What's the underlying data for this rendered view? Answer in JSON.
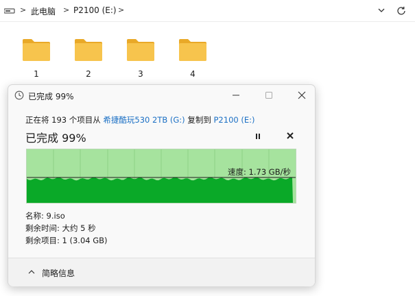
{
  "address_bar": {
    "crumbs": [
      "此电脑",
      "P2100 (E:)"
    ]
  },
  "folders": [
    {
      "name": "1"
    },
    {
      "name": "2"
    },
    {
      "name": "3"
    },
    {
      "name": "4"
    }
  ],
  "dialog": {
    "title": "已完成 99%",
    "copy_prefix": "正在将 193 个项目从 ",
    "source": "希捷酷玩530 2TB (G:)",
    "copy_middle": " 复制到 ",
    "destination": "P2100 (E:)",
    "percent_label": "已完成 99%",
    "progress_fraction": 0.99,
    "speed_text": "速度: 1.73 GB/秒",
    "name_line": "名称: 9.iso",
    "time_line": "剩余时间: 大约 5 秒",
    "items_line": "剩余项目: 1 (3.04 GB)",
    "more_info_label": "简略信息"
  },
  "colors": {
    "graph_fill": "#0aa928",
    "graph_bg": "#a6e39e",
    "link": "#1a6fc4",
    "folder": "#f4c04e"
  },
  "icons": {
    "address_bar": "drive-icon",
    "title": "clock-icon",
    "pause": "pause-icon",
    "cancel": "close-icon",
    "more": "chevron-up-icon"
  }
}
